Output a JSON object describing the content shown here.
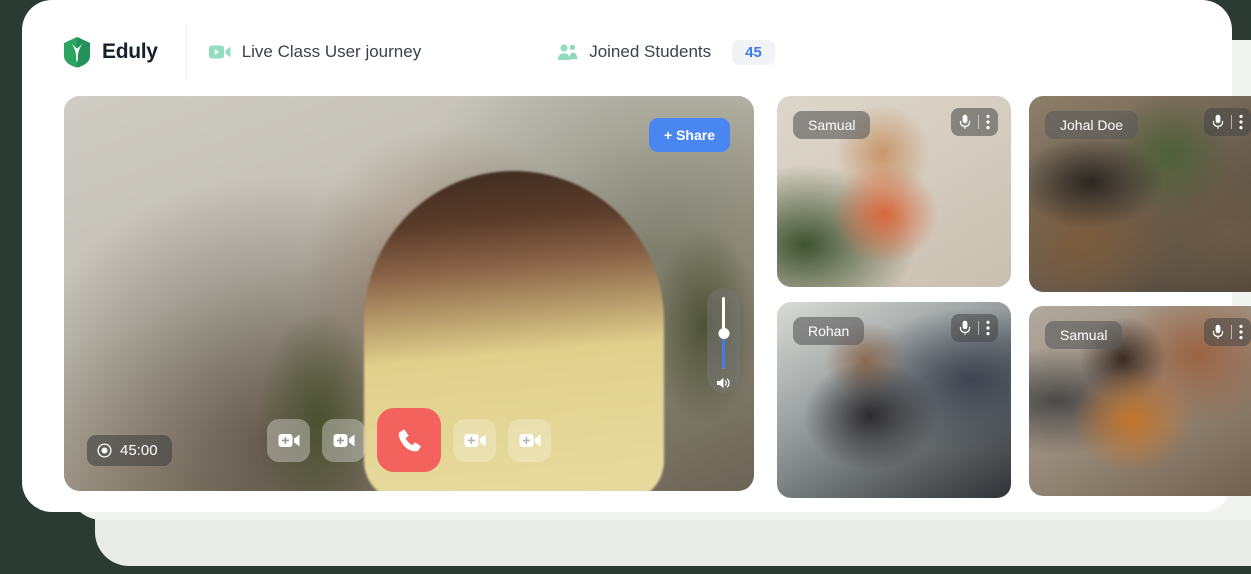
{
  "brand": {
    "name": "Eduly",
    "logo_icon": "shield-pen-logo",
    "logo_color": "#2aa560"
  },
  "header": {
    "nav_item": {
      "icon": "video-camera-icon",
      "icon_color": "#92ddbd",
      "label": "Live Class User journey"
    },
    "students": {
      "icon": "people-icon",
      "icon_color": "#92ddbd",
      "label": "Joined Students",
      "count": "45",
      "count_color": "#3d7beb"
    }
  },
  "main_video": {
    "share_button": {
      "label": "+ Share",
      "color": "#4a86f0"
    },
    "timer": {
      "icon": "record-icon",
      "value": "45:00"
    },
    "controls": [
      {
        "name": "add-camera-left-2",
        "icon": "video-plus-icon"
      },
      {
        "name": "add-camera-left-1",
        "icon": "video-plus-icon"
      },
      {
        "name": "end-call",
        "icon": "phone-icon",
        "color": "#f4625e"
      },
      {
        "name": "add-camera-right-1",
        "icon": "video-plus-icon"
      },
      {
        "name": "add-camera-right-2",
        "icon": "video-plus-icon"
      }
    ],
    "volume": {
      "icon": "speaker-icon",
      "level": 53,
      "fill_color": "#3f7fe8"
    }
  },
  "participants": [
    {
      "name": "Samual",
      "mic_icon": "microphone-icon",
      "menu_icon": "more-vertical-icon"
    },
    {
      "name": "Johal Doe",
      "mic_icon": "microphone-icon",
      "menu_icon": "more-vertical-icon"
    },
    {
      "name": "Rohan",
      "mic_icon": "microphone-icon",
      "menu_icon": "more-vertical-icon"
    },
    {
      "name": "Samual",
      "mic_icon": "microphone-icon",
      "menu_icon": "more-vertical-icon"
    }
  ]
}
